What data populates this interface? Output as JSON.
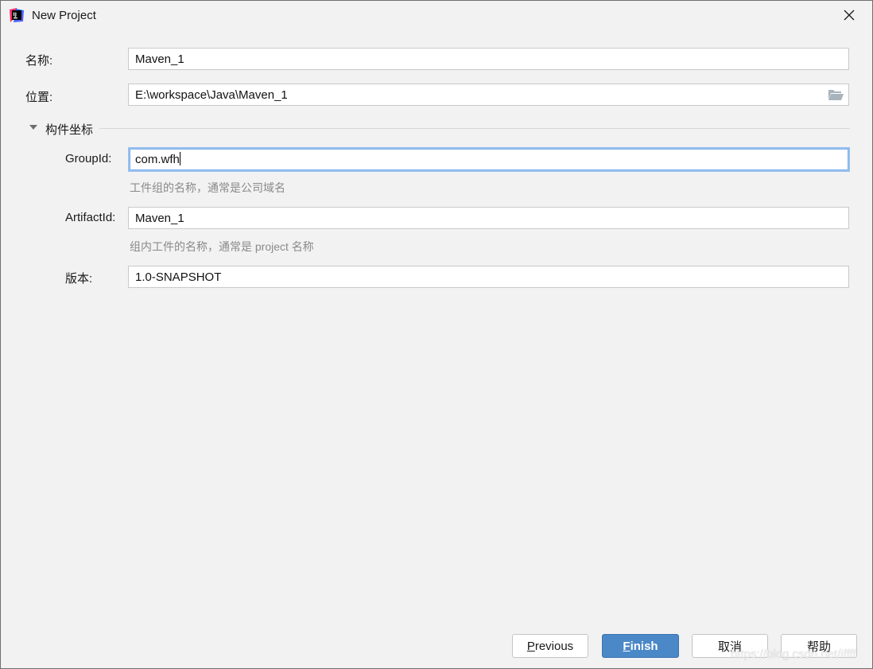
{
  "window": {
    "title": "New Project",
    "app_icon": "intellij-idea-icon",
    "close_icon": "close-icon"
  },
  "form": {
    "name": {
      "label": "名称:",
      "value": "Maven_1"
    },
    "location": {
      "label": "位置:",
      "value": "E:\\workspace\\Java\\Maven_1",
      "browse_icon": "folder-open-icon"
    },
    "section": {
      "title": "构件坐标",
      "expanded": true
    },
    "group_id": {
      "label": "GroupId:",
      "value": "com.wfh",
      "hint": "工件组的名称，通常是公司域名"
    },
    "artifact_id": {
      "label": "ArtifactId:",
      "value": "Maven_1",
      "hint": "组内工件的名称，通常是 project 名称"
    },
    "version": {
      "label": "版本:",
      "value": "1.0-SNAPSHOT"
    }
  },
  "buttons": {
    "previous": {
      "mnemonic": "P",
      "rest": "revious"
    },
    "finish": {
      "mnemonic": "F",
      "rest": "inish"
    },
    "cancel": "取消",
    "help": "帮助"
  },
  "colors": {
    "primary_button": "#4a88c7",
    "focus_border": "#97c0f0",
    "background": "#f2f2f2"
  },
  "watermark": "https://blog.csdn.net/iffff"
}
